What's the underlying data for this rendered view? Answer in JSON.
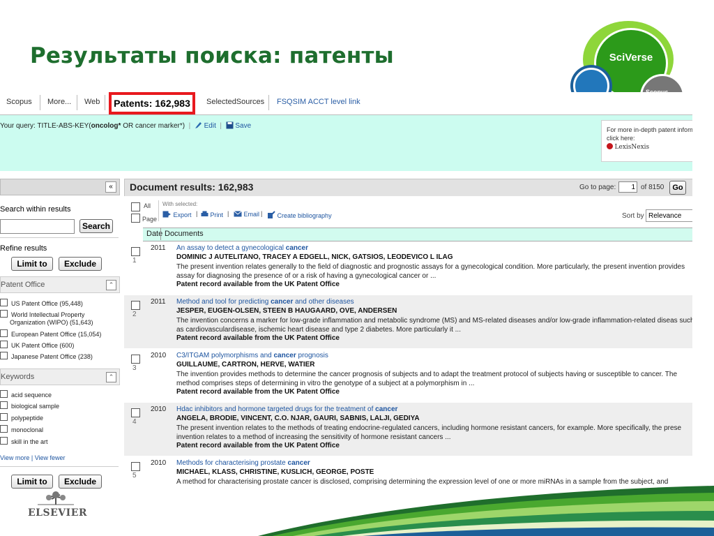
{
  "slide": {
    "title": "Результаты поиска: патенты",
    "logo_text": "SciVerse",
    "logo_sub": "Scopus",
    "footer_brand": "ELSEVIER"
  },
  "tabs": [
    {
      "label": "Scopus"
    },
    {
      "label": "More..."
    },
    {
      "label": "Web"
    },
    {
      "label": "Patents: 162,983"
    },
    {
      "label": "SelectedSources"
    },
    {
      "label": "FSQSIM ACCT level link"
    }
  ],
  "query": {
    "prefix": "Your query:",
    "text_start": "TITLE-ABS-KEY(",
    "text_bold": "oncolog*",
    "text_mid": " OR cancer marker*",
    "text_end": ")",
    "edit_label": "Edit",
    "save_label": "Save"
  },
  "lexis": {
    "line1": "For more in-depth patent inform",
    "line2": "click here:",
    "brand": "LexisNexis"
  },
  "sidebar": {
    "collapse_icon": "«",
    "search_within_label": "Search within results",
    "search_input_value": "",
    "search_button": "Search",
    "refine_label": "Refine results",
    "limit_to": "Limit to",
    "exclude": "Exclude",
    "patent_office_label": "Patent Office",
    "patent_offices": [
      {
        "label": "US Patent Office (95,448)"
      },
      {
        "label": "World Intellectual Property"
      },
      {
        "label": "Organization (WIPO) (51,643)"
      },
      {
        "label": "European Patent Office (15,054)"
      },
      {
        "label": "UK Patent Office (600)"
      },
      {
        "label": "Japanese Patent Office (238)"
      }
    ],
    "keywords_label": "Keywords",
    "keywords": [
      {
        "label": "acid sequence"
      },
      {
        "label": "biological sample"
      },
      {
        "label": "polypeptide"
      },
      {
        "label": "monoclonal"
      },
      {
        "label": "skill in the art"
      }
    ],
    "view_more": "View more",
    "view_fewer": "View fewer"
  },
  "results": {
    "title": "Document results: 162,983",
    "goto_label": "Go to page:",
    "goto_value": "1",
    "of_pages": "of 8150",
    "go_button": "Go",
    "all_label": "All",
    "page_label": "Page",
    "with_selected": "With selected:",
    "export": "Export",
    "print": "Print",
    "email": "Email",
    "create_bibliography": "Create bibliography",
    "sort_by": "Sort by",
    "sort_value": "Relevance",
    "col_date": "Date",
    "col_documents": "Documents",
    "rows": [
      {
        "num": "1",
        "year": "2011",
        "title_pre": "An assay to detect a gynecological ",
        "title_hl": "cancer",
        "title_post": "",
        "authors": "DOMINIC J AUTELITANO,   TRACEY A EDGELL,   NICK, GATSIOS,   LEODEVICO L ILAG",
        "abstract": "The present invention relates generally to the field of diagnostic and prognostic assays for a gynecological condition. More particularly, the present invention provides assay for diagnosing the presence of or a risk of having a gynecological cancer or ...",
        "source": "Patent record available from the UK Patent Office"
      },
      {
        "num": "2",
        "year": "2011",
        "title_pre": "Method and tool for predicting ",
        "title_hl": "cancer",
        "title_post": " and other diseases",
        "authors": "JESPER, EUGEN-OLSEN,   STEEN B HAUGAARD,   OVE, ANDERSEN",
        "abstract": "The invention concerns a marker for low-grade inflammation and metabolic syndrome (MS) and MS-related diseases and/or low-grade inflammation-related diseas such as cardiovasculardisease, ischemic heart disease and type 2 diabetes. More particularly it ...",
        "source": "Patent record available from the UK Patent Office"
      },
      {
        "num": "3",
        "year": "2010",
        "title_pre": "C3/ITGAM polymorphisms and ",
        "title_hl": "cancer",
        "title_post": " prognosis",
        "authors": "GUILLAUME, CARTRON,   HERVE, WATIER",
        "abstract": "The invention provides methods to determine the cancer prognosis of subjects and to adapt the treatment protocol of subjects having or susceptible to cancer. The method comprises steps of determining in vitro the genotype of a subject at a polymorphism in ...",
        "source": "Patent record available from the UK Patent Office"
      },
      {
        "num": "4",
        "year": "2010",
        "title_pre": "Hdac inhibitors and hormone targeted drugs for the treatment of ",
        "title_hl": "cancer",
        "title_post": "",
        "authors": "ANGELA, BRODIE,   VINCENT, C.O. NJAR,   GAURI, SABNIS,   LALJI, GEDIYA",
        "abstract": "The present invention relates to the methods of treating endocrine-regulated cancers, including hormone resistant cancers, for example. More specifically, the prese invention relates to a method of increasing the sensitivity of hormone resistant cancers ...",
        "source": "Patent record available from the UK Patent Office"
      },
      {
        "num": "5",
        "year": "2010",
        "title_pre": "Methods for characterising prostate ",
        "title_hl": "cancer",
        "title_post": "",
        "authors": "MICHAEL, KLASS,   CHRISTINE, KUSLICH,   GEORGE, POSTE",
        "abstract": "A method for characterising prostate cancer is disclosed, comprising determining the expression level of one or more miRNAs in a sample from the subject, and",
        "source": ""
      }
    ]
  },
  "colors": {
    "title_green": "#1e6e2e",
    "highlight_red": "#e8191e",
    "link_blue": "#1e55a0",
    "query_bg": "#ccfcf0"
  }
}
